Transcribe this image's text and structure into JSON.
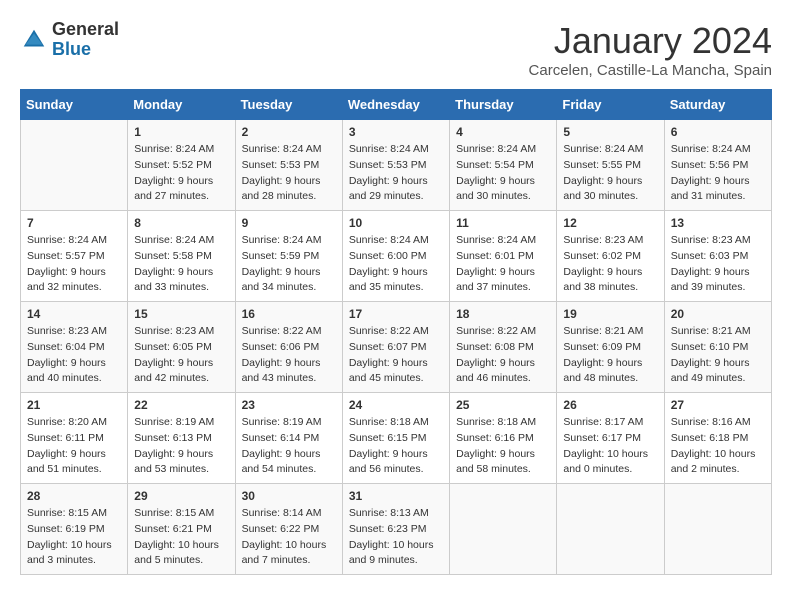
{
  "logo": {
    "general": "General",
    "blue": "Blue"
  },
  "header": {
    "month": "January 2024",
    "location": "Carcelen, Castille-La Mancha, Spain"
  },
  "weekdays": [
    "Sunday",
    "Monday",
    "Tuesday",
    "Wednesday",
    "Thursday",
    "Friday",
    "Saturday"
  ],
  "weeks": [
    [
      {
        "day": "",
        "sunrise": "",
        "sunset": "",
        "daylight": ""
      },
      {
        "day": "1",
        "sunrise": "Sunrise: 8:24 AM",
        "sunset": "Sunset: 5:52 PM",
        "daylight": "Daylight: 9 hours and 27 minutes."
      },
      {
        "day": "2",
        "sunrise": "Sunrise: 8:24 AM",
        "sunset": "Sunset: 5:53 PM",
        "daylight": "Daylight: 9 hours and 28 minutes."
      },
      {
        "day": "3",
        "sunrise": "Sunrise: 8:24 AM",
        "sunset": "Sunset: 5:53 PM",
        "daylight": "Daylight: 9 hours and 29 minutes."
      },
      {
        "day": "4",
        "sunrise": "Sunrise: 8:24 AM",
        "sunset": "Sunset: 5:54 PM",
        "daylight": "Daylight: 9 hours and 30 minutes."
      },
      {
        "day": "5",
        "sunrise": "Sunrise: 8:24 AM",
        "sunset": "Sunset: 5:55 PM",
        "daylight": "Daylight: 9 hours and 30 minutes."
      },
      {
        "day": "6",
        "sunrise": "Sunrise: 8:24 AM",
        "sunset": "Sunset: 5:56 PM",
        "daylight": "Daylight: 9 hours and 31 minutes."
      }
    ],
    [
      {
        "day": "7",
        "sunrise": "Sunrise: 8:24 AM",
        "sunset": "Sunset: 5:57 PM",
        "daylight": "Daylight: 9 hours and 32 minutes."
      },
      {
        "day": "8",
        "sunrise": "Sunrise: 8:24 AM",
        "sunset": "Sunset: 5:58 PM",
        "daylight": "Daylight: 9 hours and 33 minutes."
      },
      {
        "day": "9",
        "sunrise": "Sunrise: 8:24 AM",
        "sunset": "Sunset: 5:59 PM",
        "daylight": "Daylight: 9 hours and 34 minutes."
      },
      {
        "day": "10",
        "sunrise": "Sunrise: 8:24 AM",
        "sunset": "Sunset: 6:00 PM",
        "daylight": "Daylight: 9 hours and 35 minutes."
      },
      {
        "day": "11",
        "sunrise": "Sunrise: 8:24 AM",
        "sunset": "Sunset: 6:01 PM",
        "daylight": "Daylight: 9 hours and 37 minutes."
      },
      {
        "day": "12",
        "sunrise": "Sunrise: 8:23 AM",
        "sunset": "Sunset: 6:02 PM",
        "daylight": "Daylight: 9 hours and 38 minutes."
      },
      {
        "day": "13",
        "sunrise": "Sunrise: 8:23 AM",
        "sunset": "Sunset: 6:03 PM",
        "daylight": "Daylight: 9 hours and 39 minutes."
      }
    ],
    [
      {
        "day": "14",
        "sunrise": "Sunrise: 8:23 AM",
        "sunset": "Sunset: 6:04 PM",
        "daylight": "Daylight: 9 hours and 40 minutes."
      },
      {
        "day": "15",
        "sunrise": "Sunrise: 8:23 AM",
        "sunset": "Sunset: 6:05 PM",
        "daylight": "Daylight: 9 hours and 42 minutes."
      },
      {
        "day": "16",
        "sunrise": "Sunrise: 8:22 AM",
        "sunset": "Sunset: 6:06 PM",
        "daylight": "Daylight: 9 hours and 43 minutes."
      },
      {
        "day": "17",
        "sunrise": "Sunrise: 8:22 AM",
        "sunset": "Sunset: 6:07 PM",
        "daylight": "Daylight: 9 hours and 45 minutes."
      },
      {
        "day": "18",
        "sunrise": "Sunrise: 8:22 AM",
        "sunset": "Sunset: 6:08 PM",
        "daylight": "Daylight: 9 hours and 46 minutes."
      },
      {
        "day": "19",
        "sunrise": "Sunrise: 8:21 AM",
        "sunset": "Sunset: 6:09 PM",
        "daylight": "Daylight: 9 hours and 48 minutes."
      },
      {
        "day": "20",
        "sunrise": "Sunrise: 8:21 AM",
        "sunset": "Sunset: 6:10 PM",
        "daylight": "Daylight: 9 hours and 49 minutes."
      }
    ],
    [
      {
        "day": "21",
        "sunrise": "Sunrise: 8:20 AM",
        "sunset": "Sunset: 6:11 PM",
        "daylight": "Daylight: 9 hours and 51 minutes."
      },
      {
        "day": "22",
        "sunrise": "Sunrise: 8:19 AM",
        "sunset": "Sunset: 6:13 PM",
        "daylight": "Daylight: 9 hours and 53 minutes."
      },
      {
        "day": "23",
        "sunrise": "Sunrise: 8:19 AM",
        "sunset": "Sunset: 6:14 PM",
        "daylight": "Daylight: 9 hours and 54 minutes."
      },
      {
        "day": "24",
        "sunrise": "Sunrise: 8:18 AM",
        "sunset": "Sunset: 6:15 PM",
        "daylight": "Daylight: 9 hours and 56 minutes."
      },
      {
        "day": "25",
        "sunrise": "Sunrise: 8:18 AM",
        "sunset": "Sunset: 6:16 PM",
        "daylight": "Daylight: 9 hours and 58 minutes."
      },
      {
        "day": "26",
        "sunrise": "Sunrise: 8:17 AM",
        "sunset": "Sunset: 6:17 PM",
        "daylight": "Daylight: 10 hours and 0 minutes."
      },
      {
        "day": "27",
        "sunrise": "Sunrise: 8:16 AM",
        "sunset": "Sunset: 6:18 PM",
        "daylight": "Daylight: 10 hours and 2 minutes."
      }
    ],
    [
      {
        "day": "28",
        "sunrise": "Sunrise: 8:15 AM",
        "sunset": "Sunset: 6:19 PM",
        "daylight": "Daylight: 10 hours and 3 minutes."
      },
      {
        "day": "29",
        "sunrise": "Sunrise: 8:15 AM",
        "sunset": "Sunset: 6:21 PM",
        "daylight": "Daylight: 10 hours and 5 minutes."
      },
      {
        "day": "30",
        "sunrise": "Sunrise: 8:14 AM",
        "sunset": "Sunset: 6:22 PM",
        "daylight": "Daylight: 10 hours and 7 minutes."
      },
      {
        "day": "31",
        "sunrise": "Sunrise: 8:13 AM",
        "sunset": "Sunset: 6:23 PM",
        "daylight": "Daylight: 10 hours and 9 minutes."
      },
      {
        "day": "",
        "sunrise": "",
        "sunset": "",
        "daylight": ""
      },
      {
        "day": "",
        "sunrise": "",
        "sunset": "",
        "daylight": ""
      },
      {
        "day": "",
        "sunrise": "",
        "sunset": "",
        "daylight": ""
      }
    ]
  ]
}
